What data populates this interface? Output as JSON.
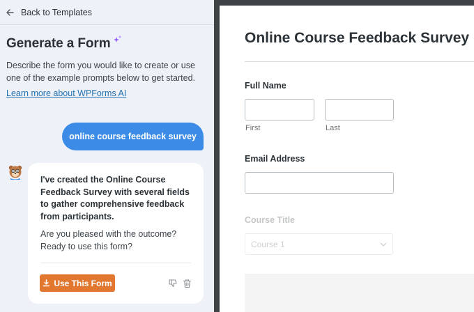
{
  "left": {
    "back_label": "Back to Templates",
    "heading": "Generate a Form",
    "description": "Describe the form you would like to create or use one of the example prompts below to get started.",
    "learn_link": "Learn more about WPForms AI",
    "user_prompt": "online course feedback survey",
    "ai_message": "I've created the Online Course Feedback Survey with several fields to gather comprehensive feedback from participants.",
    "ai_question": "Are you pleased with the outcome? Ready to use this form?",
    "use_button": "Use This Form"
  },
  "preview": {
    "form_title": "Online Course Feedback Survey",
    "full_name_label": "Full Name",
    "first_sublabel": "First",
    "last_sublabel": "Last",
    "email_label": "Email Address",
    "course_label": "Course Title",
    "course_select_value": "Course 1"
  },
  "colors": {
    "accent_blue": "#3c8ce7",
    "link_blue": "#2271b1",
    "button_orange": "#e27730",
    "panel_bg": "#eef2f8",
    "sparkle_purple": "#8f5cf7"
  },
  "icons": [
    "arrow-left-icon",
    "sparkle-icon",
    "bear-avatar-icon",
    "download-icon",
    "thumbs-down-icon",
    "trash-icon",
    "chevron-down-icon"
  ]
}
